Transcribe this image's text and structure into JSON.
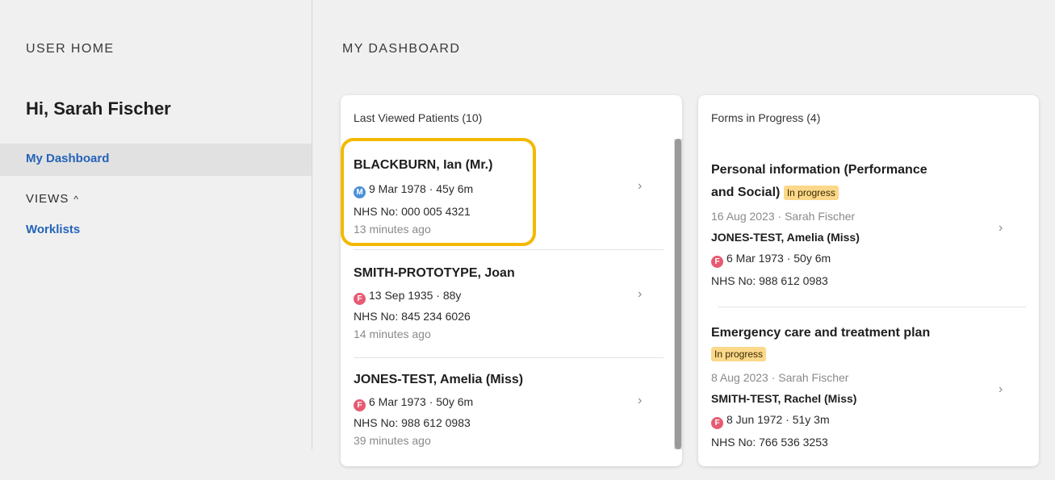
{
  "sidebar": {
    "heading": "USER HOME",
    "greeting": "Hi, Sarah Fischer",
    "active_item": "My Dashboard",
    "views_label": "VIEWS",
    "views_caret": "^",
    "worklists": "Worklists"
  },
  "main": {
    "heading": "MY DASHBOARD"
  },
  "last_viewed": {
    "title": "Last Viewed Patients (10)",
    "patients": [
      {
        "name": "BLACKBURN,  Ian  (Mr.)",
        "sex_badge": "M",
        "dob_age": "9 Mar 1978 · 45y 6m",
        "nhs": "NHS No: 000 005 4321",
        "time": "13 minutes ago"
      },
      {
        "name": "SMITH-PROTOTYPE,  Joan",
        "sex_badge": "F",
        "dob_age": "13 Sep 1935 · 88y",
        "nhs": "NHS No: 845 234 6026",
        "time": "14 minutes ago"
      },
      {
        "name": "JONES-TEST,  Amelia  (Miss)",
        "sex_badge": "F",
        "dob_age": "6 Mar 1973 · 50y 6m",
        "nhs": "NHS No: 988 612 0983",
        "time": "39 minutes ago"
      }
    ]
  },
  "forms": {
    "title": "Forms in Progress (4)",
    "items": [
      {
        "title_line1": "Personal information (Performance",
        "title_line2": "and Social)",
        "status": "In progress",
        "meta": "16 Aug 2023  · Sarah Fischer",
        "patient": "JONES-TEST,  Amelia  (Miss)",
        "sex_badge": "F",
        "dob_age": "6 Mar 1973 · 50y 6m",
        "nhs": "NHS No: 988 612 0983"
      },
      {
        "title_line1": "Emergency care and treatment plan",
        "status": "In progress",
        "meta": "8 Aug 2023  · Sarah Fischer",
        "patient": "SMITH-TEST,  Rachel  (Miss)",
        "sex_badge": "F",
        "dob_age": "8 Jun 1972 · 51y 3m",
        "nhs": "NHS No: 766 536 3253"
      }
    ]
  },
  "icons": {
    "chevron": "›"
  },
  "colors": {
    "accent_link": "#2563b8",
    "highlight": "#f5b800",
    "badge_male": "#4a90d9",
    "badge_female": "#e75b72",
    "status_in_progress": "#fcd88a"
  }
}
